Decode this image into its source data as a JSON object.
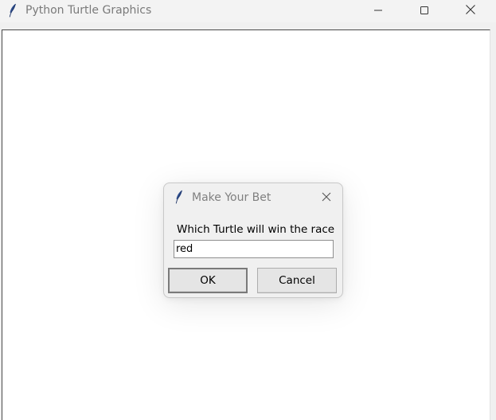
{
  "window": {
    "title": "Python Turtle Graphics",
    "icon": "feather-icon"
  },
  "window_controls": {
    "minimize": "minimize-icon",
    "maximize": "maximize-icon",
    "close": "close-icon"
  },
  "dialog": {
    "title": "Make Your Bet",
    "icon": "feather-icon",
    "prompt": "Which Turtle will win the race",
    "input_value": "red",
    "ok_label": "OK",
    "cancel_label": "Cancel"
  },
  "colors": {
    "titlebar_bg": "#f3f3f3",
    "canvas_bg": "#ffffff",
    "dialog_bg": "#f0f0f0",
    "feather_blue": "#2f4f8f"
  }
}
